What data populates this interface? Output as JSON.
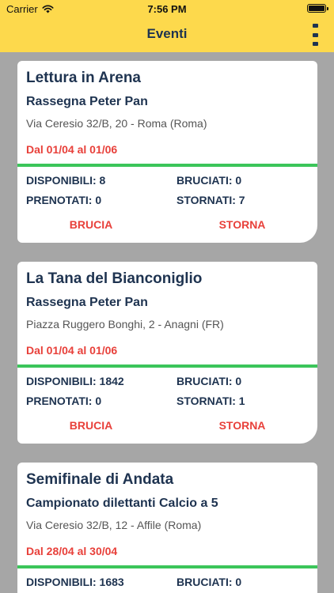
{
  "status_bar": {
    "carrier": "Carrier",
    "time": "7:56 PM"
  },
  "header": {
    "title": "Eventi"
  },
  "labels": {
    "disponibili": "DISPONIBILI:",
    "bruciati": "BRUCIATI:",
    "prenotati": "PRENOTATI:",
    "stornati": "STORNATI:",
    "brucia": "BRUCIA",
    "storna": "STORNA"
  },
  "events": [
    {
      "title": "Lettura in Arena",
      "subtitle": "Rassegna Peter Pan",
      "address": "Via Ceresio 32/B, 20 - Roma (Roma)",
      "dates": "Dal 01/04 al 01/06",
      "disponibili": "DISPONIBILI: 8",
      "bruciati": "BRUCIATI: 0",
      "prenotati": "PRENOTATI: 0",
      "stornati": "STORNATI: 7"
    },
    {
      "title": "La Tana del Bianconiglio",
      "subtitle": "Rassegna Peter Pan",
      "address": "Piazza Ruggero Bonghi, 2 - Anagni (FR)",
      "dates": "Dal 01/04 al 01/06",
      "disponibili": "DISPONIBILI: 1842",
      "bruciati": "BRUCIATI: 0",
      "prenotati": "PRENOTATI: 0",
      "stornati": "STORNATI: 1"
    },
    {
      "title": "Semifinale di Andata",
      "subtitle": "Campionato dilettanti Calcio a 5",
      "address": "Via Ceresio 32/B, 12 - Affile (Roma)",
      "dates": "Dal 28/04 al 30/04",
      "disponibili": "DISPONIBILI: 1683",
      "bruciati": "BRUCIATI: 0",
      "prenotati": "",
      "stornati": ""
    }
  ]
}
